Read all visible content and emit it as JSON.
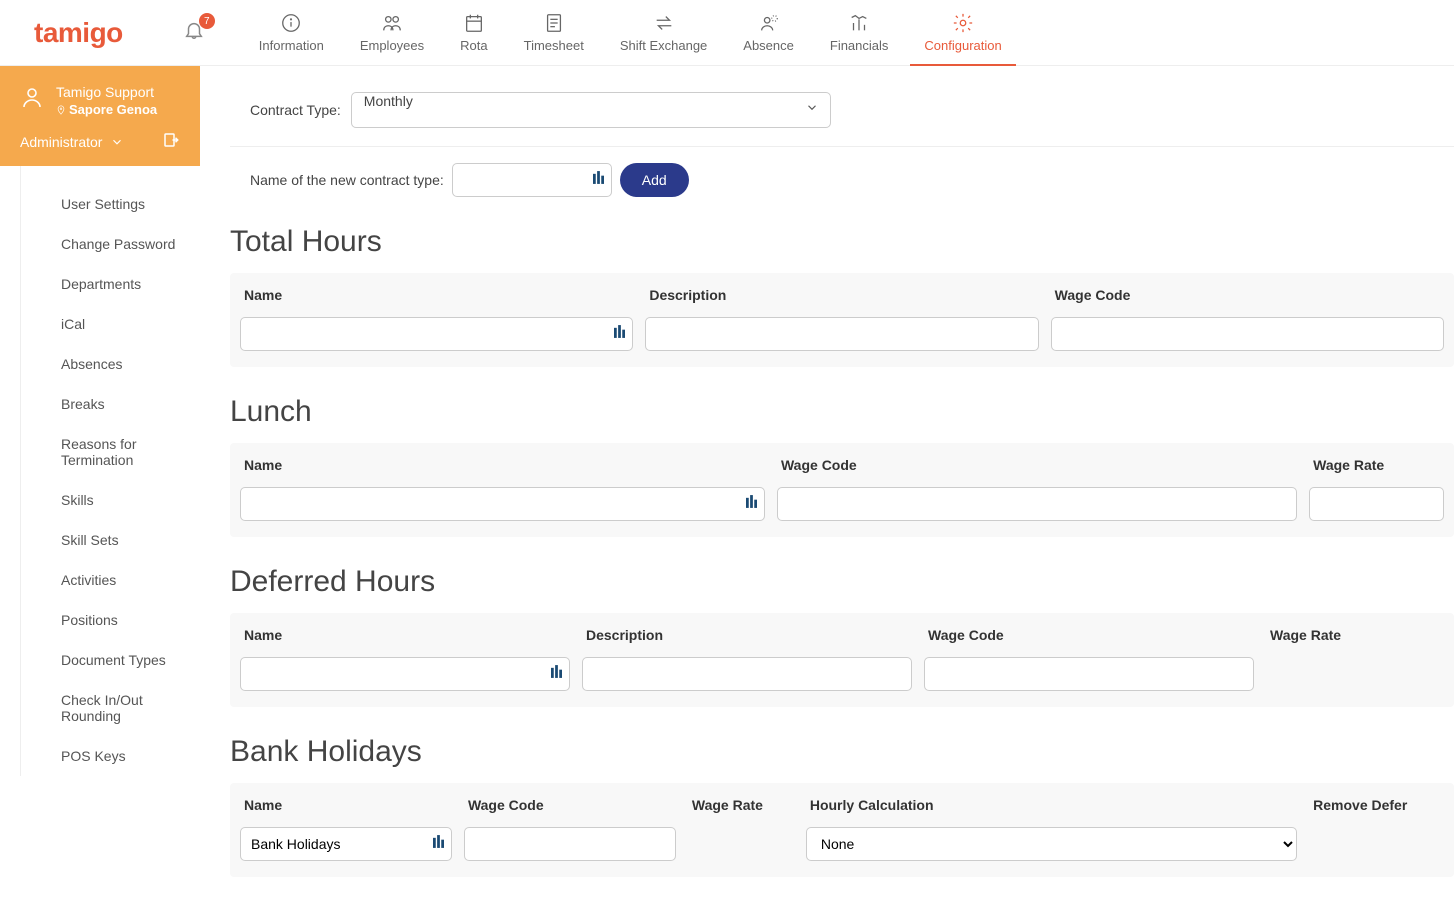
{
  "logo": "tamigo",
  "notification_count": "7",
  "nav": [
    {
      "label": "Information"
    },
    {
      "label": "Employees"
    },
    {
      "label": "Rota"
    },
    {
      "label": "Timesheet"
    },
    {
      "label": "Shift Exchange"
    },
    {
      "label": "Absence"
    },
    {
      "label": "Financials"
    },
    {
      "label": "Configuration"
    }
  ],
  "user": {
    "name": "Tamigo Support",
    "location": "Sapore Genoa",
    "role": "Administrator"
  },
  "side_nav": [
    "User Settings",
    "Change Password",
    "Departments",
    "iCal",
    "Absences",
    "Breaks",
    "Reasons for Termination",
    "Skills",
    "Skill Sets",
    "Activities",
    "Positions",
    "Document Types",
    "Check In/Out Rounding",
    "POS Keys"
  ],
  "labels": {
    "contract_type": "Contract Type:",
    "contract_type_value": "Monthly",
    "new_contract_name": "Name of the new contract type:",
    "add_btn": "Add"
  },
  "sections": {
    "total_hours": {
      "title": "Total Hours",
      "cols": [
        "Name",
        "Description",
        "Wage Code"
      ]
    },
    "lunch": {
      "title": "Lunch",
      "cols": [
        "Name",
        "Wage Code",
        "Wage Rate"
      ]
    },
    "deferred": {
      "title": "Deferred Hours",
      "cols": [
        "Name",
        "Description",
        "Wage Code",
        "Wage Rate"
      ]
    },
    "bank_holidays": {
      "title": "Bank Holidays",
      "cols": [
        "Name",
        "Wage Code",
        "Wage Rate",
        "Hourly Calculation",
        "Remove Defer"
      ],
      "name_value": "Bank Holidays",
      "hourly_calc_value": "None"
    }
  }
}
